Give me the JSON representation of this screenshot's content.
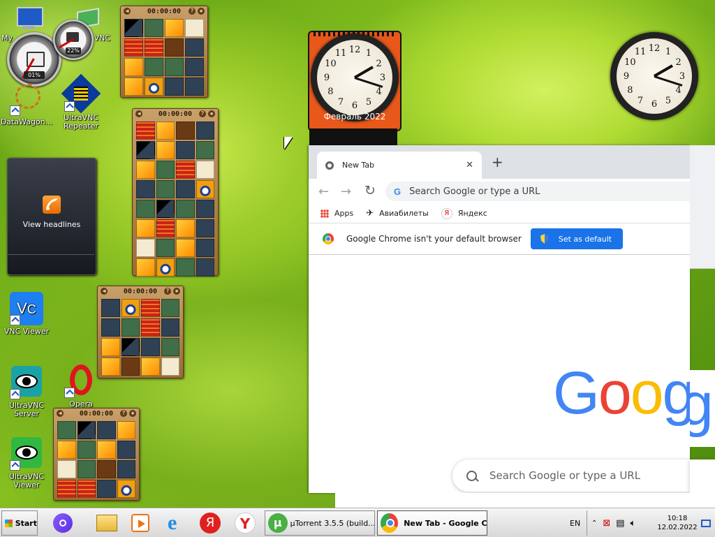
{
  "desktop_icons": [
    {
      "id": "my-computer",
      "label": "My"
    },
    {
      "id": "vnc-top",
      "label": "VNC"
    },
    {
      "id": "datawagon",
      "label": "DataWagon..."
    },
    {
      "id": "ultravnc-repeater",
      "label": "UltraVNC Repeater"
    },
    {
      "id": "vnc-viewer",
      "label": "VNC Viewer"
    },
    {
      "id": "opera",
      "label": "Opera Browser"
    },
    {
      "id": "ultravnc-server",
      "label": "UltraVNC Server"
    },
    {
      "id": "ultravnc-viewer",
      "label": "UltraVNC Viewer"
    }
  ],
  "gauges": {
    "cpu_label": "01%",
    "mem_label": "22%"
  },
  "puzzles": [
    {
      "time": "00:00:00"
    },
    {
      "time": "00:00:00"
    },
    {
      "time": "00:00:00"
    },
    {
      "time": "00:00:00"
    }
  ],
  "headlines_gadget": {
    "label": "View headlines"
  },
  "calendar_clock": {
    "date_text": "Февраль 2022"
  },
  "clock_numbers": [
    "12",
    "1",
    "2",
    "3",
    "4",
    "5",
    "6",
    "7",
    "8",
    "9",
    "10",
    "11"
  ],
  "chrome": {
    "tab_title": "New Tab",
    "omnibox_placeholder": "Search Google or type a URL",
    "bookmarks": [
      {
        "label": "Apps",
        "icon": "apps-grid-icon"
      },
      {
        "label": "Авиабилеты",
        "icon": "plane-icon"
      },
      {
        "label": "Яндекс",
        "icon": "yandex-icon"
      }
    ],
    "infobar_text": "Google Chrome isn't your default browser",
    "set_default_label": "Set as default",
    "logo_text": "Google",
    "logo_colors": [
      "#4285F4",
      "#EA4335",
      "#FBBC05",
      "#4285F4",
      "#34A853",
      "#EA4335"
    ],
    "ntp_search_placeholder": "Search Google or type a URL"
  },
  "taskbar": {
    "start_label": "Start",
    "tasks": [
      {
        "label": "µTorrent 3.5.5  (build..."
      },
      {
        "label": "New Tab - Google C..."
      }
    ],
    "language": "EN",
    "time": "10:18",
    "date": "12.02.2022"
  }
}
